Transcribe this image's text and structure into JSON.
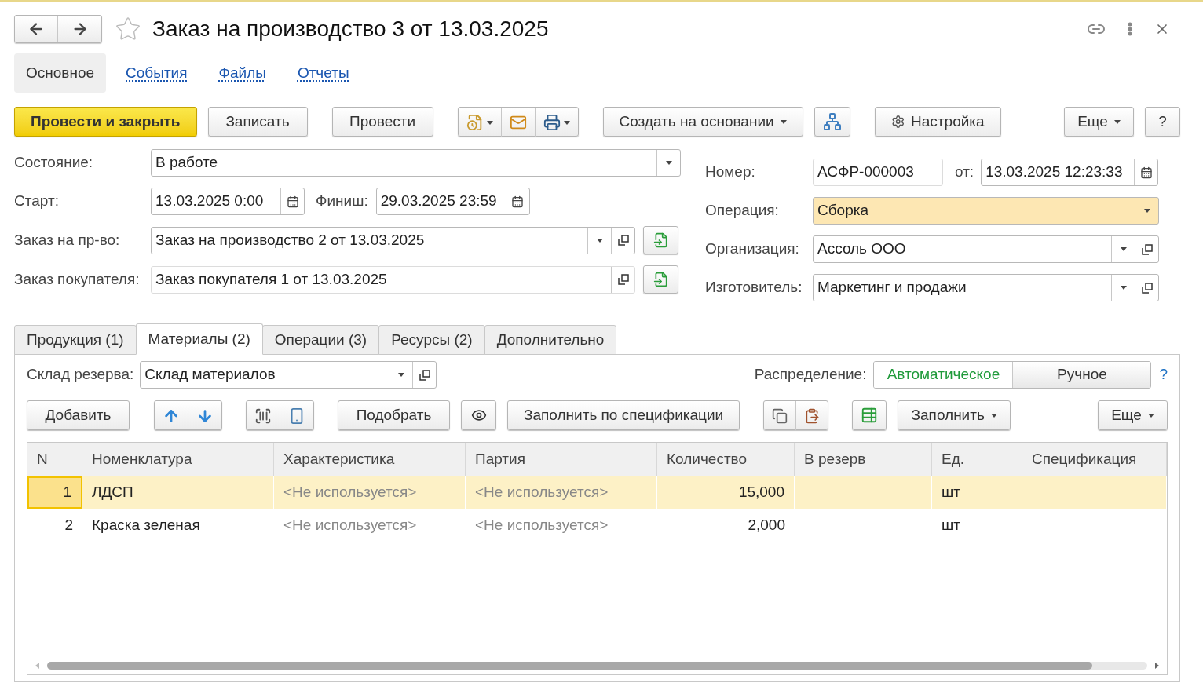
{
  "window": {
    "title": "Заказ на производство 3 от 13.03.2025",
    "favorite": false
  },
  "nav_tabs": [
    {
      "label": "Основное",
      "selected": true
    },
    {
      "label": "События",
      "selected": false
    },
    {
      "label": "Файлы",
      "selected": false
    },
    {
      "label": "Отчеты",
      "selected": false
    }
  ],
  "toolbar": {
    "post_and_close": "Провести и закрыть",
    "save": "Записать",
    "post": "Провести",
    "create_based_on": "Создать на основании",
    "settings": "Настройка",
    "more": "Еще",
    "help": "?"
  },
  "header_left": {
    "state": {
      "label": "Состояние:",
      "value": "В работе"
    },
    "start": {
      "label": "Старт:",
      "value": "13.03.2025  0:00"
    },
    "finish": {
      "label": "Финиш:",
      "value": "29.03.2025 23:59"
    },
    "production_order": {
      "label": "Заказ на пр-во:",
      "value": "Заказ на производство 2 от 13.03.2025"
    },
    "customer_order": {
      "label": "Заказ покупателя:",
      "value": "Заказ покупателя 1 от 13.03.2025"
    }
  },
  "header_right": {
    "number": {
      "label": "Номер:",
      "value": "АСФР-000003"
    },
    "date": {
      "label": "от:",
      "value": "13.03.2025 12:23:33"
    },
    "operation": {
      "label": "Операция:",
      "value": "Сборка",
      "highlighted": true
    },
    "organization": {
      "label": "Организация:",
      "value": "Ассоль ООО"
    },
    "manufacturer": {
      "label": "Изготовитель:",
      "value": "Маркетинг и продажи"
    }
  },
  "content_tabs": [
    {
      "label": "Продукция (1)",
      "selected": false
    },
    {
      "label": "Материалы (2)",
      "selected": true
    },
    {
      "label": "Операции (3)",
      "selected": false
    },
    {
      "label": "Ресурсы (2)",
      "selected": false
    },
    {
      "label": "Дополнительно",
      "selected": false
    }
  ],
  "materials": {
    "warehouse": {
      "label": "Склад резерва:",
      "value": "Склад материалов"
    },
    "distribution": {
      "label": "Распределение:",
      "options": [
        {
          "label": "Автоматическое",
          "selected": true
        },
        {
          "label": "Ручное",
          "selected": false
        }
      ],
      "help": "?"
    },
    "buttons": {
      "add": "Добавить",
      "pick": "Подобрать",
      "fill_by_spec": "Заполнить по спецификации",
      "fill": "Заполнить",
      "more": "Еще"
    },
    "columns": [
      "N",
      "Номенклатура",
      "Характеристика",
      "Партия",
      "Количество",
      "В резерв",
      "Ед.",
      "Спецификация"
    ],
    "rows": [
      {
        "n": "1",
        "item": "ЛДСП",
        "characteristic": "<Не используется>",
        "batch": "<Не используется>",
        "quantity": "15,000",
        "unit": "шт",
        "selected": true
      },
      {
        "n": "2",
        "item": "Краска зеленая",
        "characteristic": "<Не используется>",
        "batch": "<Не используется>",
        "quantity": "2,000",
        "unit": "шт",
        "selected": false
      }
    ]
  }
}
